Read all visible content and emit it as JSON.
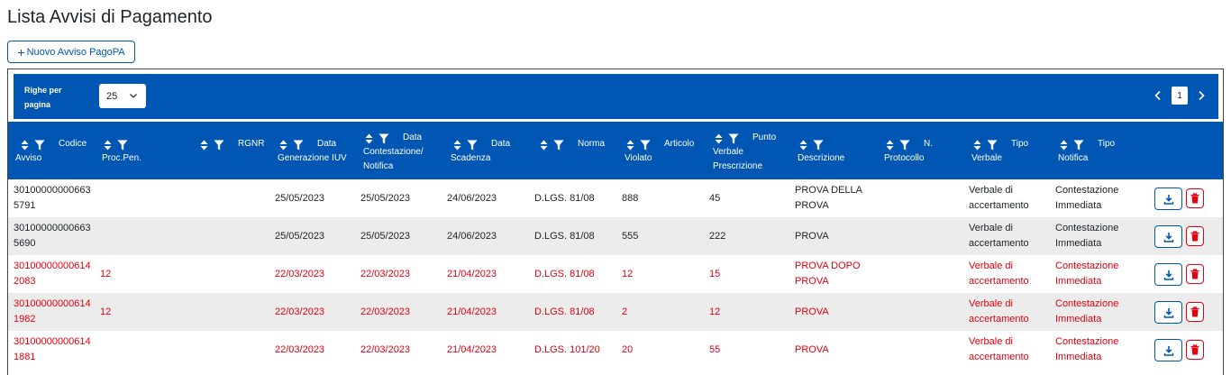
{
  "page": {
    "title": "Lista Avvisi di Pagamento",
    "new_button": "Nuovo Avviso PagoPA"
  },
  "toolbar": {
    "rows_per_page_label": "Righe per pagina",
    "rows_per_page_value": "25",
    "current_page": "1"
  },
  "columns": [
    {
      "line1": "Codice",
      "line2": "Avviso"
    },
    {
      "line1": "",
      "line2": "Proc.Pen."
    },
    {
      "line1": "RGNR",
      "line2": ""
    },
    {
      "line1": "Data",
      "line2": "Generazione IUV"
    },
    {
      "line1": "Data",
      "line2": "Contestazione/",
      "line3": "Notifica"
    },
    {
      "line1": "Data",
      "line2": "Scadenza"
    },
    {
      "line1": "Norma",
      "line2": ""
    },
    {
      "line1": "Articolo",
      "line2": "Violato"
    },
    {
      "line1": "Punto",
      "line2": "Verbale",
      "line3": "Prescrizione"
    },
    {
      "line1": "",
      "line2": "Descrizione"
    },
    {
      "line1": "N.",
      "line2": "Protocollo"
    },
    {
      "line1": "Tipo",
      "line2": "Verbale"
    },
    {
      "line1": "Tipo",
      "line2": "Notifica"
    }
  ],
  "rows": [
    {
      "codice": [
        "30100000000663",
        "5791"
      ],
      "proc_pen": "",
      "rgnr": "",
      "data_iuv": "25/05/2023",
      "data_contestazione": "25/05/2023",
      "data_scadenza": "24/06/2023",
      "norma": "D.LGS. 81/08",
      "articolo": "888",
      "punto": "45",
      "descrizione": [
        "PROVA DELLA",
        "PROVA"
      ],
      "protocollo": "",
      "tipo_verbale": [
        "Verbale di",
        "accertamento"
      ],
      "tipo_notifica": [
        "Contestazione",
        "Immediata"
      ]
    },
    {
      "codice": [
        "30100000000663",
        "5690"
      ],
      "proc_pen": "",
      "rgnr": "",
      "data_iuv": "25/05/2023",
      "data_contestazione": "25/05/2023",
      "data_scadenza": "24/06/2023",
      "norma": "D.LGS. 81/08",
      "articolo": "555",
      "punto": "222",
      "descrizione": [
        "PROVA",
        ""
      ],
      "protocollo": "",
      "tipo_verbale": [
        "Verbale di",
        "accertamento"
      ],
      "tipo_notifica": [
        "Contestazione",
        "Immediata"
      ]
    },
    {
      "codice": [
        "30100000000614",
        "2083"
      ],
      "proc_pen": "12",
      "rgnr": "",
      "data_iuv": "22/03/2023",
      "data_contestazione": "22/03/2023",
      "data_scadenza": "21/04/2023",
      "norma": "D.LGS. 81/08",
      "articolo": "12",
      "punto": "15",
      "descrizione": [
        "PROVA DOPO",
        "PROVA"
      ],
      "protocollo": "",
      "tipo_verbale": [
        "Verbale di",
        "accertamento"
      ],
      "tipo_notifica": [
        "Contestazione",
        "Immediata"
      ]
    },
    {
      "codice": [
        "30100000000614",
        "1982"
      ],
      "proc_pen": "12",
      "rgnr": "",
      "data_iuv": "22/03/2023",
      "data_contestazione": "22/03/2023",
      "data_scadenza": "21/04/2023",
      "norma": "D.LGS. 81/08",
      "articolo": "2",
      "punto": "12",
      "descrizione": [
        "PROVA",
        ""
      ],
      "protocollo": "",
      "tipo_verbale": [
        "Verbale di",
        "accertamento"
      ],
      "tipo_notifica": [
        "Contestazione",
        "Immediata"
      ]
    },
    {
      "codice": [
        "30100000000614",
        "1881"
      ],
      "proc_pen": "",
      "rgnr": "",
      "data_iuv": "22/03/2023",
      "data_contestazione": "22/03/2023",
      "data_scadenza": "21/04/2023",
      "norma": "D.LGS. 101/20",
      "articolo": "20",
      "punto": "55",
      "descrizione": [
        "PROVA",
        ""
      ],
      "protocollo": "",
      "tipo_verbale": [
        "Verbale di",
        "accertamento"
      ],
      "tipo_notifica": [
        "Contestazione",
        "Immediata"
      ]
    }
  ],
  "row_status": [
    "normal",
    "normal",
    "expired",
    "expired",
    "expired"
  ],
  "colors": {
    "primary": "#0056b3",
    "danger": "#e3000f",
    "row_alt": "#ececec"
  },
  "icons": {
    "new_button": "plus-icon",
    "sort": "sort-icon",
    "filter": "filter-icon",
    "download": "download-icon",
    "delete": "trash-icon",
    "prev": "chevron-left-icon",
    "next": "chevron-right-icon",
    "select": "chevron-down-icon"
  }
}
